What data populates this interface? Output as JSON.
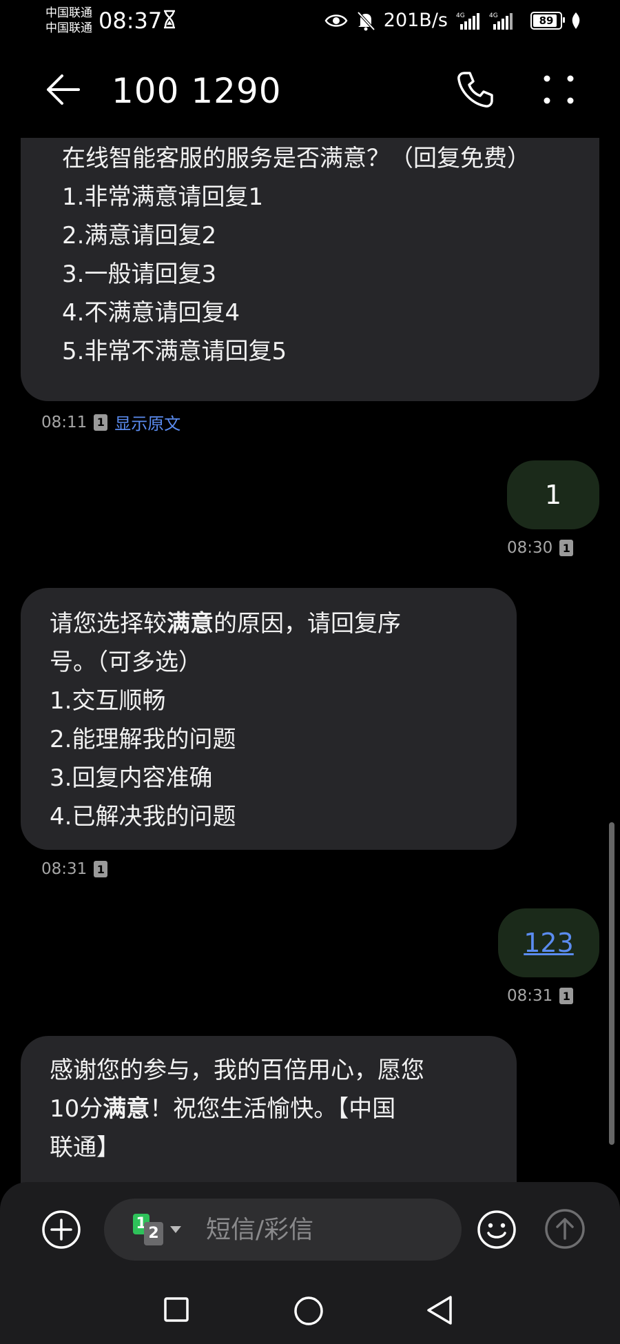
{
  "status_bar": {
    "carrier_1": "中国联通",
    "carrier_2": "中国联通",
    "time": "08:37",
    "speed": "201B/s",
    "network_1": "4G",
    "network_2": "4G",
    "battery": "89",
    "icons": [
      "hourglass-icon",
      "eye-icon",
      "bell-muted-icon",
      "signal-icon",
      "battery-icon",
      "leaf-icon"
    ]
  },
  "header": {
    "title": "100 1290",
    "back_icon": "arrow-left-icon",
    "call_icon": "phone-icon",
    "more_icon": "more-vertical-icon"
  },
  "messages": [
    {
      "direction": "incoming",
      "lines": [
        "在线智能客服的服务是否满意？（回复免费）",
        "1.非常满意请回复1",
        "2.满意请回复2",
        "3.一般请回复3",
        "4.不满意请回复4",
        "5.非常不满意请回复5"
      ],
      "time": "08:11",
      "sim": "1",
      "action": "显示原文"
    },
    {
      "direction": "outgoing",
      "text": "1",
      "time": "08:30",
      "sim": "1"
    },
    {
      "direction": "incoming",
      "line1_pre": "请您选择较",
      "line1_bold": "满意",
      "line1_post": "的原因，请回复序",
      "lines": [
        "号。（可多选）",
        "1.交互顺畅",
        "2.能理解我的问题",
        "3.回复内容准确",
        "4.已解决我的问题"
      ],
      "time": "08:31",
      "sim": "1"
    },
    {
      "direction": "outgoing",
      "text": "123",
      "time": "08:31",
      "sim": "1"
    },
    {
      "direction": "incoming",
      "line1": "感谢您的参与，我的百倍用心，愿您",
      "line2_pre": "10分",
      "line2_bold": "满意",
      "line2_post": "！祝您生活愉快。【中国",
      "line3": "联通】"
    }
  ],
  "composer": {
    "add_icon": "plus-circle-icon",
    "sim_1": "1",
    "sim_2": "2",
    "placeholder": "短信/彩信",
    "emoji_icon": "smiley-icon",
    "send_icon": "send-arrow-up-icon"
  },
  "nav": {
    "recents_icon": "square-icon",
    "home_icon": "circle-icon",
    "back_icon": "triangle-back-icon"
  },
  "colors": {
    "background": "#000000",
    "incoming_bubble": "#262629",
    "outgoing_bubble": "#1b2a1a",
    "link": "#5b8cf0",
    "meta_text": "#a6a6a6"
  }
}
